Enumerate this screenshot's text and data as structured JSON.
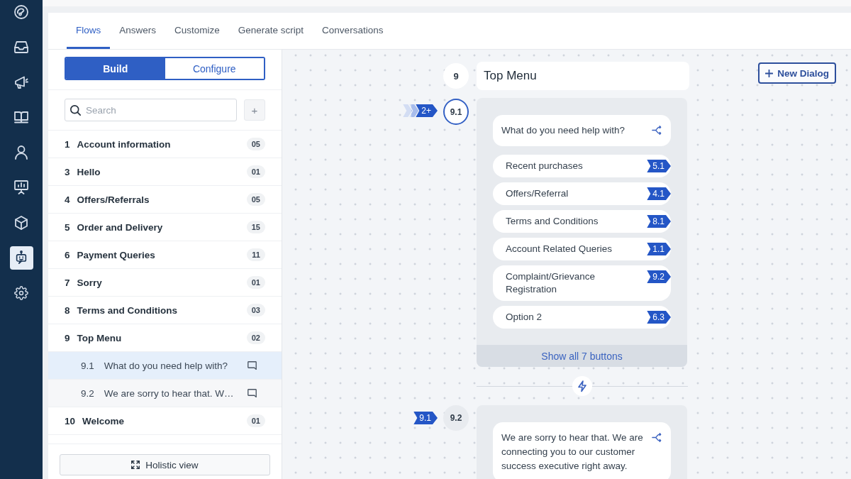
{
  "nav_rail": {
    "items": [
      {
        "selected": false
      },
      {
        "selected": false
      },
      {
        "selected": false
      },
      {
        "selected": false
      },
      {
        "selected": false
      },
      {
        "selected": false
      },
      {
        "selected": false
      },
      {
        "selected": true
      },
      {
        "selected": false
      }
    ]
  },
  "tabs": [
    {
      "label": "Flows",
      "selected": true
    },
    {
      "label": "Answers",
      "selected": false
    },
    {
      "label": "Customize",
      "selected": false
    },
    {
      "label": "Generate script",
      "selected": false
    },
    {
      "label": "Conversations",
      "selected": false
    }
  ],
  "flows_panel": {
    "mode_switch": [
      {
        "label": "Build",
        "selected": true
      },
      {
        "label": "Configure",
        "selected": false
      }
    ],
    "search": {
      "placeholder": "Search"
    },
    "add_button": {
      "label": "+",
      "disabled": true
    },
    "flows": [
      {
        "number": "1",
        "name": "Account information",
        "count": "05",
        "selected": false
      },
      {
        "number": "3",
        "name": "Hello",
        "count": "01",
        "selected": false
      },
      {
        "number": "4",
        "name": "Offers/Referrals",
        "count": "05",
        "selected": false
      },
      {
        "number": "5",
        "name": "Order and Delivery",
        "count": "15",
        "selected": false
      },
      {
        "number": "6",
        "name": "Payment Queries",
        "count": "11",
        "selected": false
      },
      {
        "number": "7",
        "name": "Sorry",
        "count": "01",
        "selected": false
      },
      {
        "number": "8",
        "name": "Terms and Conditions",
        "count": "03",
        "selected": false
      },
      {
        "number": "9",
        "name": "Top Menu",
        "count": "02",
        "selected": false,
        "children": [
          {
            "number": "9.1",
            "name": "What do you need help with?",
            "selected": true
          },
          {
            "number": "9.2",
            "name": "We are sorry to hear that. W…",
            "selected": false
          }
        ]
      },
      {
        "number": "10",
        "name": "Welcome",
        "count": "01",
        "selected": false
      }
    ],
    "holistic_view_button": {
      "label": "Holistic view"
    }
  },
  "canvas": {
    "new_dialog_button": {
      "label": "New Dialog"
    },
    "flow": {
      "number": "9",
      "title": "Top Menu"
    },
    "dialogs": [
      {
        "number": "9.1",
        "selected": true,
        "incoming": {
          "label": "2+",
          "stacked": true
        },
        "message": "What do you need help with?",
        "buttons": [
          {
            "label": "Recent purchases",
            "target": "5.1"
          },
          {
            "label": "Offers/Referral",
            "target": "4.1"
          },
          {
            "label": "Terms and Conditions",
            "target": "8.1"
          },
          {
            "label": "Account Related Queries",
            "target": "1.1"
          },
          {
            "label": "Complaint/Grievance Registration",
            "target": "9.2"
          },
          {
            "label": "Option 2",
            "target": "6.3"
          }
        ],
        "show_all": "Show all 7 buttons"
      },
      {
        "number": "9.2",
        "selected": false,
        "incoming": {
          "label": "9.1",
          "stacked": false
        },
        "message": "We are sorry to hear that. We are connecting you to our customer success executive right away."
      }
    ]
  }
}
